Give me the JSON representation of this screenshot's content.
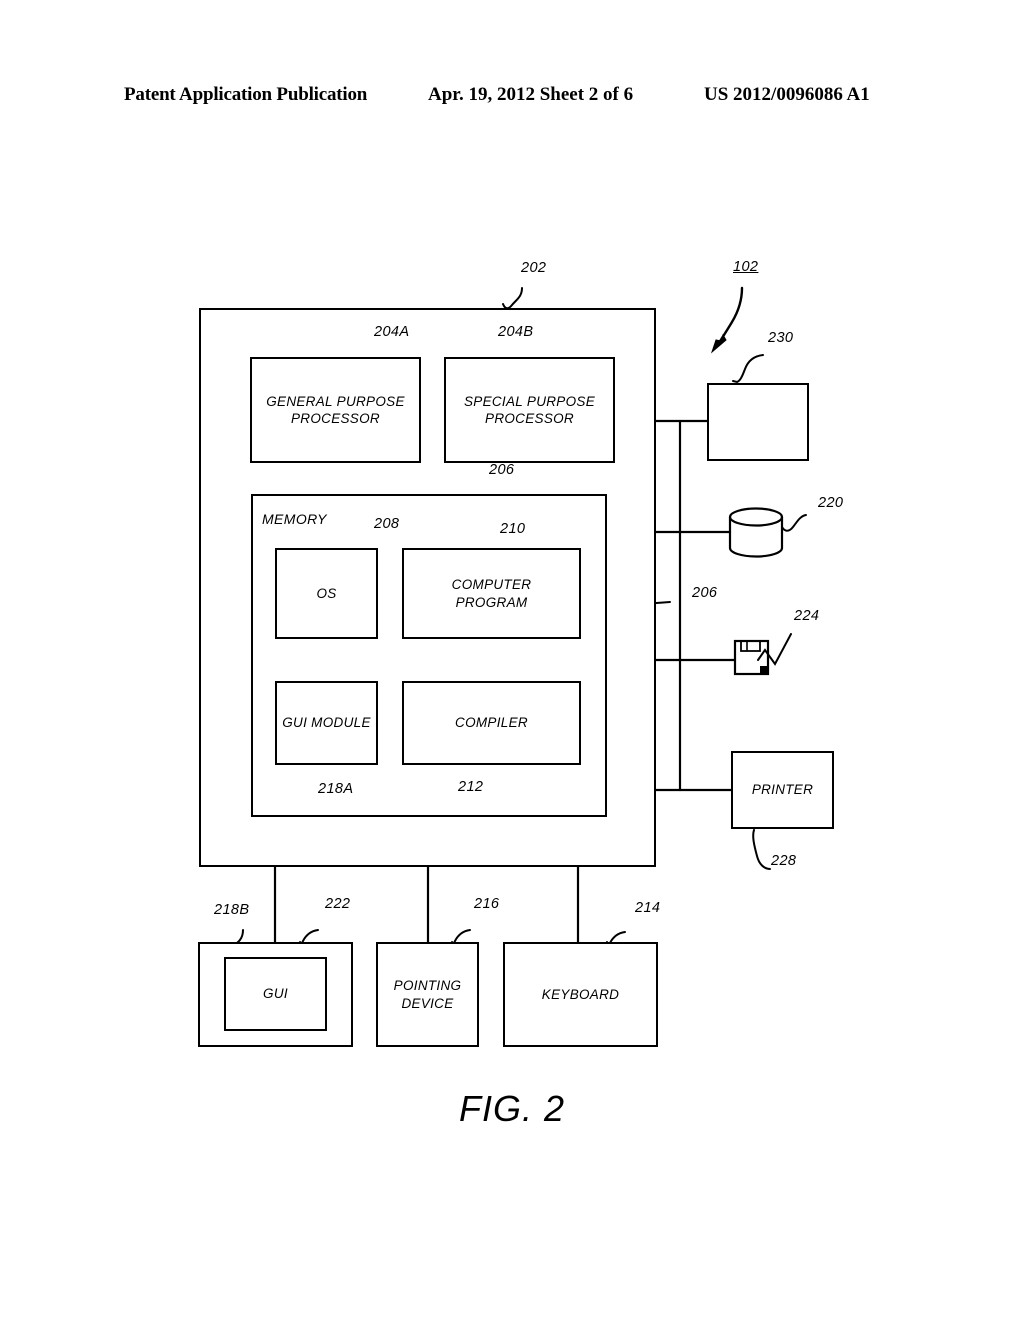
{
  "header": {
    "publication": "Patent Application Publication",
    "date_sheet": "Apr. 19, 2012  Sheet 2 of 6",
    "patent_number": "US 2012/0096086 A1"
  },
  "figure": {
    "caption": "FIG. 2",
    "system_ref": "102"
  },
  "boxes": {
    "outer_system_ref": "202",
    "general_purpose_processor": {
      "label": "GENERAL PURPOSE\nPROCESSOR",
      "ref": "204A"
    },
    "special_purpose_processor": {
      "label": "SPECIAL PURPOSE\nPROCESSOR",
      "ref": "204B"
    },
    "memory": {
      "label": "MEMORY",
      "ref": "206"
    },
    "os": {
      "label": "OS",
      "ref": "208"
    },
    "computer_program": {
      "label": "COMPUTER\nPROGRAM",
      "ref": "210"
    },
    "gui_module": {
      "label": "GUI MODULE",
      "ref": "218A"
    },
    "compiler": {
      "label": "COMPILER",
      "ref": "212"
    },
    "bus_right": {
      "ref": "206"
    },
    "device_230": {
      "label": "",
      "ref": "230"
    },
    "data_storage": {
      "label": "",
      "ref": "220"
    },
    "removable_media": {
      "label": "",
      "ref": "224"
    },
    "printer": {
      "label": "PRINTER",
      "ref": "228"
    },
    "gui_display": {
      "label": "",
      "ref": "222"
    },
    "gui": {
      "label": "GUI",
      "ref": "218B"
    },
    "pointing_device": {
      "label": "POINTING\nDEVICE",
      "ref": "216"
    },
    "keyboard": {
      "label": "KEYBOARD",
      "ref": "214"
    }
  },
  "icons": {
    "cylinder": "database-cylinder-icon",
    "floppy": "floppy-disk-icon",
    "arrow": "system-pointer-arrow-icon"
  },
  "colors": {
    "ink": "#000000",
    "paper": "#ffffff"
  }
}
